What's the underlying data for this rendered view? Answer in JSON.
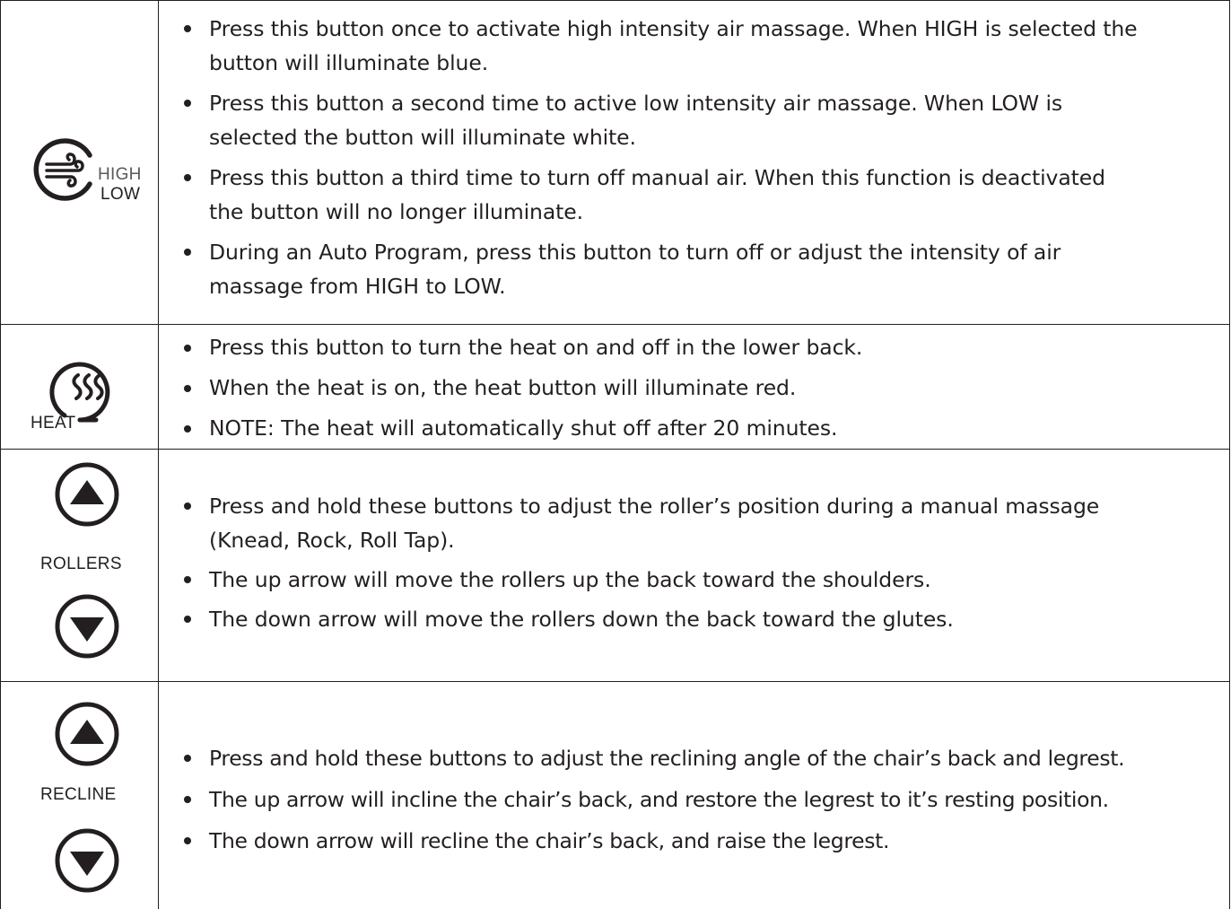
{
  "rows": [
    {
      "icon": "air-massage-icon",
      "labels": {
        "high": "HIGH",
        "low": "LOW"
      },
      "bullets": [
        {
          "line1": "Press this button once to activate high intensity air massage. When HIGH is selected the",
          "line2": "button will illuminate blue."
        },
        {
          "line1": "Press this button a second time to active low intensity air massage. When LOW is",
          "line2": "selected the button will illuminate white."
        },
        {
          "line1": "Press this button a third time to turn off manual air. When this function is deactivated",
          "line2": "the button will no longer illuminate."
        },
        {
          "line1": "During an Auto Program, press this button to turn off or adjust the intensity of air",
          "line2": "massage from HIGH to LOW."
        }
      ]
    },
    {
      "icon": "heat-icon",
      "labels": {
        "heat": "HEAT"
      },
      "bullets": [
        {
          "line1": "Press this button to turn the heat on and off in the lower back."
        },
        {
          "line1": "When the heat is on, the heat button will illuminate red."
        },
        {
          "line1": "NOTE: The heat will automatically shut off after 20 minutes."
        }
      ]
    },
    {
      "icon": "rollers-arrows-icon",
      "labels": {
        "name": "ROLLERS"
      },
      "bullets": [
        {
          "line1": "Press and hold these buttons to adjust the roller’s position during a manual massage",
          "line2": "(Knead, Rock, Roll Tap)."
        },
        {
          "line1": "The up arrow will move the rollers up the back toward the shoulders."
        },
        {
          "line1": "The down arrow will move the rollers down the back toward the glutes."
        }
      ]
    },
    {
      "icon": "recline-arrows-icon",
      "labels": {
        "name": "RECLINE"
      },
      "bullets": [
        {
          "line1": "Press and hold these buttons to adjust the reclining angle of the chair’s back and legrest."
        },
        {
          "line1": "The up arrow will incline the chair’s back, and restore the legrest to it’s resting position."
        },
        {
          "line1": "The down arrow will recline the chair’s back, and raise the legrest."
        }
      ]
    }
  ]
}
